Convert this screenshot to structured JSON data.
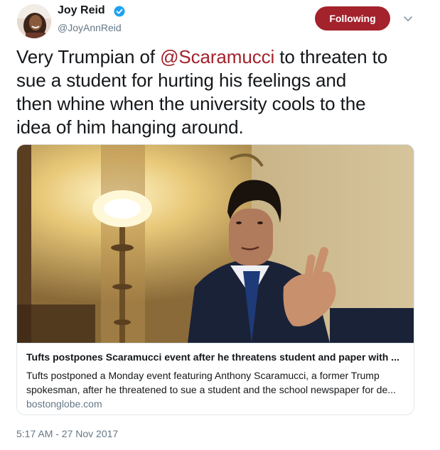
{
  "author": {
    "display_name": "Joy Reid",
    "handle": "@JoyAnnReid",
    "verified": true
  },
  "follow_button": {
    "label": "Following"
  },
  "tweet": {
    "line1_a": "Very Trumpian of ",
    "line1_mention": "@Scaramucci",
    "line1_b": " to threaten to",
    "line2": "sue a student for hurting his feelings and",
    "line3": "then whine when the university cools to the",
    "line4": "idea of him hanging around."
  },
  "card": {
    "title": "Tufts postpones Scaramucci event after he threatens student and paper with ...",
    "description_line1": "Tufts postponed a Monday event featuring Anthony Scaramucci, a former Trump",
    "description_line2": "spokesman, after he threatened to sue a student and the school newspaper for de...",
    "domain": "bostonglobe.com"
  },
  "timestamp": "5:17 AM - 27 Nov 2017",
  "colors": {
    "follow_button": "#a3222c",
    "mention": "#a3222c",
    "verified": "#1da1f2",
    "secondary_text": "#657786"
  }
}
